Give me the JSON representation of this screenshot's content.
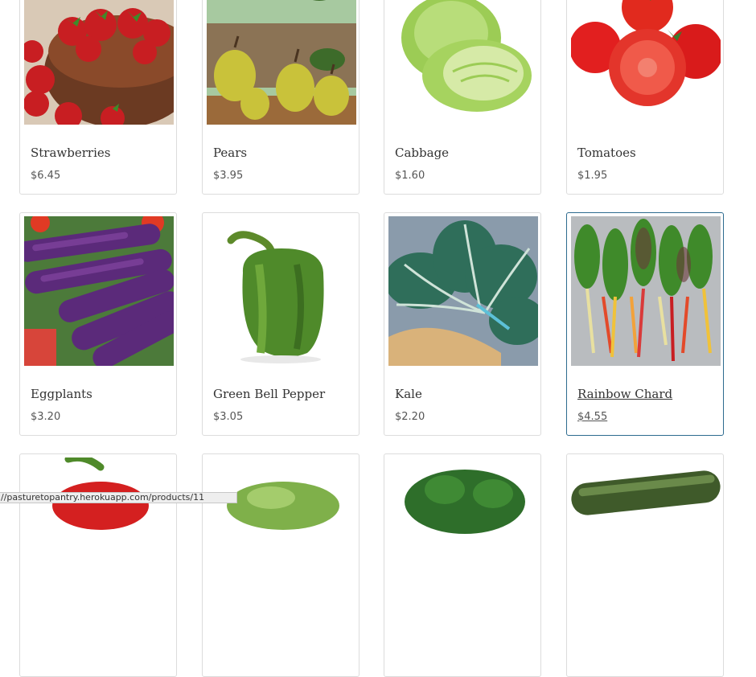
{
  "products": [
    {
      "name": "Strawberries",
      "price": "$6.45",
      "image": "strawberries-image"
    },
    {
      "name": "Pears",
      "price": "$3.95",
      "image": "pears-image"
    },
    {
      "name": "Cabbage",
      "price": "$1.60",
      "image": "cabbage-image"
    },
    {
      "name": "Tomatoes",
      "price": "$1.95",
      "image": "tomatoes-image"
    },
    {
      "name": "Eggplants",
      "price": "$3.20",
      "image": "eggplants-image"
    },
    {
      "name": "Green Bell Pepper",
      "price": "$3.05",
      "image": "green-bell-pepper-image"
    },
    {
      "name": "Kale",
      "price": "$2.20",
      "image": "kale-image"
    },
    {
      "name": "Rainbow Chard",
      "price": "$4.55",
      "image": "rainbow-chard-image",
      "hovered": true
    }
  ],
  "status_url": "//pasturetopantry.herokuapp.com/products/11",
  "colors": {
    "hover_border": "#2d6b8f",
    "card_border": "#dcdcdc"
  }
}
